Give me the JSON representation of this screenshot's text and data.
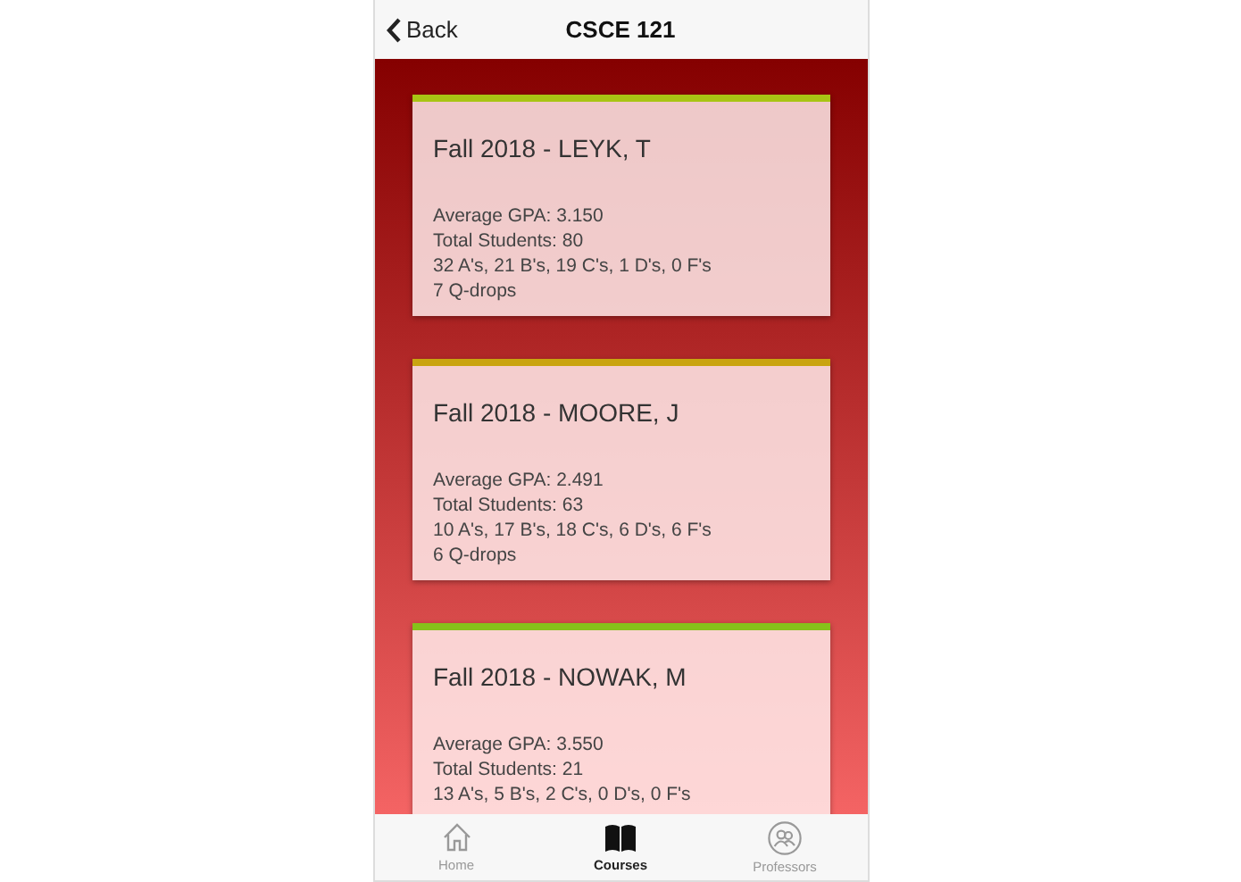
{
  "header": {
    "back_label": "Back",
    "title": "CSCE 121"
  },
  "sections": [
    {
      "title": "Fall 2018 - LEYK, T",
      "color": "#a8c414",
      "lines": [
        "Average GPA: 3.150",
        "Total Students: 80",
        "32 A's, 21 B's, 19 C's, 1 D's, 0 F's",
        "7 Q-drops"
      ]
    },
    {
      "title": "Fall 2018 - MOORE, J",
      "color": "#c9a410",
      "lines": [
        "Average GPA: 2.491",
        "Total Students: 63",
        "10 A's, 17 B's, 18 C's, 6 D's, 6 F's",
        "6 Q-drops"
      ]
    },
    {
      "title": "Fall 2018 - NOWAK, M",
      "color": "#86c21a",
      "lines": [
        "Average GPA: 3.550",
        "Total Students: 21",
        "13 A's, 5 B's, 2 C's, 0 D's, 0 F's"
      ]
    }
  ],
  "tab_bar": [
    {
      "label": "Home",
      "kind": "home",
      "selected": false
    },
    {
      "label": "Courses",
      "kind": "book",
      "selected": true
    },
    {
      "label": "Professors",
      "kind": "people",
      "selected": false
    }
  ]
}
